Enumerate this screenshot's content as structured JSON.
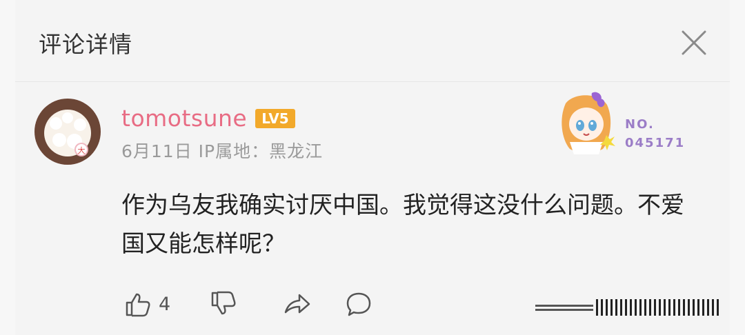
{
  "header": {
    "title": "评论详情"
  },
  "comment": {
    "username": "tomotsune",
    "level_badge": "LV5",
    "date": "6月11日",
    "ip_label": "IP属地：黑龙江",
    "text": "作为乌友我确实讨厌中国。我觉得这没什么问题。不爱国又能怎样呢？",
    "fan_badge_label": "NO.",
    "fan_badge_number": "045171",
    "likes": "4"
  },
  "colors": {
    "username": "#e86c84",
    "level_badge": "#f2a92b",
    "fan_badge_text": "#9b7dc7"
  },
  "icons": {
    "close": "close-icon",
    "like": "thumb-up-icon",
    "dislike": "thumb-down-icon",
    "share": "share-icon",
    "reply": "comment-icon"
  }
}
